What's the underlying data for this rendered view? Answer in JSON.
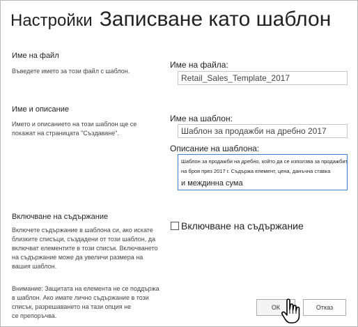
{
  "header": {
    "breadcrumb": "Настройки",
    "title": "Записване като шаблон"
  },
  "file_section": {
    "title": "Име на файл",
    "description": "Въведете името за този файл с шаблон.",
    "field_label": "Име на файла:",
    "field_value": "Retail_Sales_Template_2017"
  },
  "name_section": {
    "title": "Име и описание",
    "description_line1": "Името и описанието на този шаблон ще се",
    "description_line2": "покажат на страницата \"Създаване\".",
    "name_label": "Име на шаблон:",
    "name_value": "Шаблон за продажби на дребно 2017",
    "desc_label": "Описание на шаблона:",
    "desc_line1": "Шаблон за продажби на дребно, който да се използва за продажбите",
    "desc_line2": "на броя през 2017 г. Съдържа елемент, цена, данъчна ставка",
    "desc_line3": "и междинна сума"
  },
  "content_section": {
    "title": "Включване на съдържание",
    "desc_line1": "Включете съдържание в шаблона си, ако искате",
    "desc_line2": "близките списъци, създадени от този шаблон, да",
    "desc_line3": "включват елементите в този списък. Включването",
    "desc_line4": "на съдържание може да увеличи размера на",
    "desc_line5": "вашия шаблон.",
    "warn_line1": "Внимание: Защитата на елемента не се поддържа",
    "warn_line2": "в шаблон. Ако имате лично съдържание в този",
    "warn_line3": "списък, разрешаването на тази опция не",
    "warn_line4": "се препоръчва.",
    "checkbox_label": "Включване на съдържание",
    "checkbox_checked": false
  },
  "buttons": {
    "ok": "ОК",
    "cancel": "Отказ"
  },
  "icons": {
    "cursor": "hand-pointer-icon"
  }
}
